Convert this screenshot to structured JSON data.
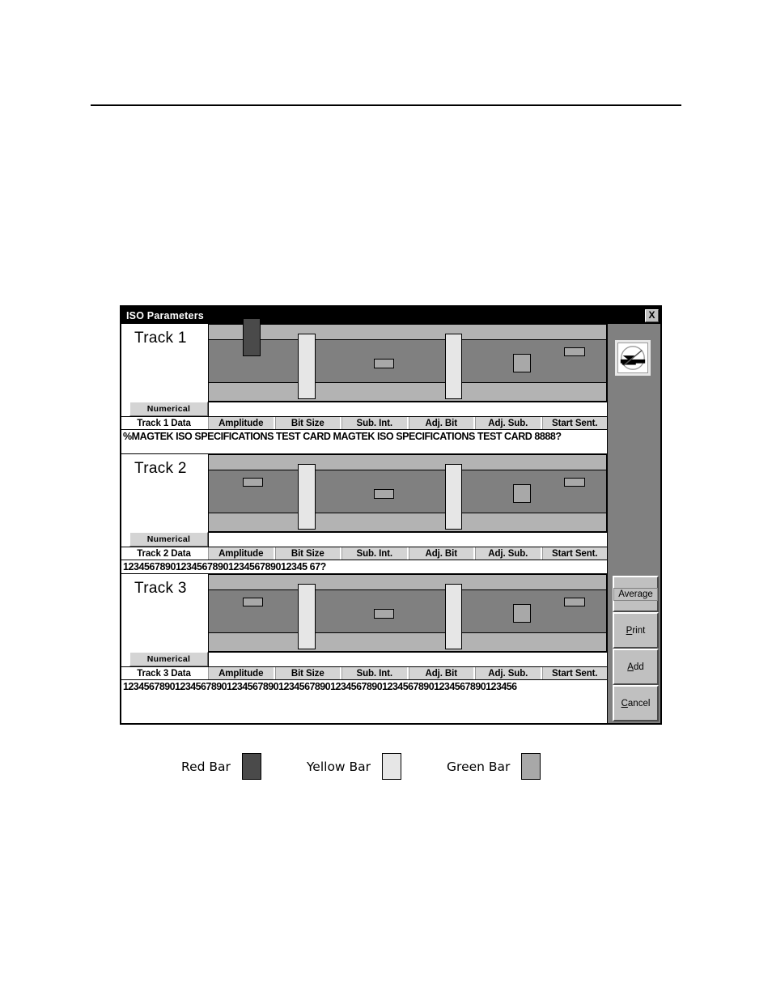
{
  "window": {
    "title": "ISO Parameters",
    "close_label": "X",
    "icon": "gauge-icon"
  },
  "columns": [
    "Amplitude",
    "Bit Size",
    "Sub. Int.",
    "Adj. Bit",
    "Adj. Sub.",
    "Start Sent."
  ],
  "numerical_label": "Numerical",
  "tracks": [
    {
      "name": "Track 1",
      "data_header": "Track 1 Data",
      "data_value": "%MAGTEK ISO SPECIFICATIONS TEST CARD MAGTEK ISO SPECIFICATIONS TEST CARD 8888?"
    },
    {
      "name": "Track 2",
      "data_header": "Track 2 Data",
      "data_value": "12345678901234567890123456789012345 67?"
    },
    {
      "name": "Track 3",
      "data_header": "Track 3 Data",
      "data_value": "1234567890123456789012345678901234567890123456789012345678901234567890123456"
    }
  ],
  "buttons": {
    "average": {
      "label": "Average",
      "mnemonic": "",
      "focused": true
    },
    "print": {
      "label": "Print",
      "mnemonic": "P"
    },
    "add": {
      "label": "Add",
      "mnemonic": "A"
    },
    "cancel": {
      "label": "Cancel",
      "mnemonic": "C"
    }
  },
  "legend": [
    {
      "label": "Red Bar",
      "color": "#4a4a4a"
    },
    {
      "label": "Yellow Bar",
      "color": "#e6e6e6"
    },
    {
      "label": "Green Bar",
      "color": "#a8a8a8"
    }
  ],
  "chart_data": {
    "type": "bar",
    "title": "ISO Parameters per track",
    "categories": [
      "Amplitude",
      "Bit Size",
      "Sub. Int.",
      "Adj. Bit",
      "Adj. Sub.",
      "Start Sent."
    ],
    "bar_colors": {
      "red": "#4a4a4a",
      "yellow": "#e6e6e6",
      "green": "#a8a8a8"
    },
    "bands": {
      "outer_tolerance": "#b3b3b3",
      "inner_tolerance": "#808080"
    },
    "legend": [
      "Red Bar",
      "Yellow Bar",
      "Green Bar"
    ],
    "series": [
      {
        "name": "Track 1",
        "bars": [
          {
            "category": "Amplitude",
            "color": "red",
            "x_pct": 8.5,
            "top_pct": -9,
            "height_pct": 50
          },
          {
            "category": "Bit Size",
            "color": "yellow",
            "x_pct": 22.5,
            "top_pct": 12,
            "height_pct": 86
          },
          {
            "category": "Sub. Int.",
            "color": "green",
            "x_pct": 41.5,
            "top_pct": 45,
            "height_pct": 12
          },
          {
            "category": "Adj. Bit",
            "color": "yellow",
            "x_pct": 59.5,
            "top_pct": 12,
            "height_pct": 86
          },
          {
            "category": "Adj. Sub.",
            "color": "green",
            "x_pct": 76.5,
            "top_pct": 38,
            "height_pct": 25
          },
          {
            "category": "Start Sent.",
            "color": "green",
            "x_pct": 89.5,
            "top_pct": 30,
            "height_pct": 11
          }
        ]
      },
      {
        "name": "Track 2",
        "bars": [
          {
            "category": "Amplitude",
            "color": "green",
            "x_pct": 8.5,
            "top_pct": 30,
            "height_pct": 11
          },
          {
            "category": "Bit Size",
            "color": "yellow",
            "x_pct": 22.5,
            "top_pct": 12,
            "height_pct": 86
          },
          {
            "category": "Sub. Int.",
            "color": "green",
            "x_pct": 41.5,
            "top_pct": 45,
            "height_pct": 12
          },
          {
            "category": "Adj. Bit",
            "color": "yellow",
            "x_pct": 59.5,
            "top_pct": 12,
            "height_pct": 86
          },
          {
            "category": "Adj. Sub.",
            "color": "green",
            "x_pct": 76.5,
            "top_pct": 38,
            "height_pct": 25
          },
          {
            "category": "Start Sent.",
            "color": "green",
            "x_pct": 89.5,
            "top_pct": 30,
            "height_pct": 11
          }
        ]
      },
      {
        "name": "Track 3",
        "bars": [
          {
            "category": "Amplitude",
            "color": "green",
            "x_pct": 8.5,
            "top_pct": 30,
            "height_pct": 11
          },
          {
            "category": "Bit Size",
            "color": "yellow",
            "x_pct": 22.5,
            "top_pct": 12,
            "height_pct": 86
          },
          {
            "category": "Sub. Int.",
            "color": "green",
            "x_pct": 41.5,
            "top_pct": 45,
            "height_pct": 12
          },
          {
            "category": "Adj. Bit",
            "color": "yellow",
            "x_pct": 59.5,
            "top_pct": 12,
            "height_pct": 86
          },
          {
            "category": "Adj. Sub.",
            "color": "green",
            "x_pct": 76.5,
            "top_pct": 38,
            "height_pct": 25
          },
          {
            "category": "Start Sent.",
            "color": "green",
            "x_pct": 89.5,
            "top_pct": 30,
            "height_pct": 11
          }
        ]
      }
    ]
  }
}
